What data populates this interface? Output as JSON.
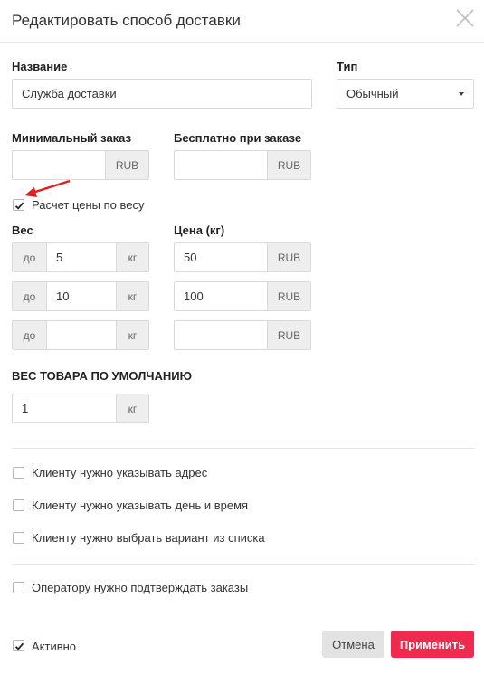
{
  "dialog": {
    "title": "Редактировать способ доставки"
  },
  "name_field": {
    "label": "Название",
    "value": "Служба доставки"
  },
  "type_field": {
    "label": "Тип",
    "value": "Обычный"
  },
  "min_order": {
    "label": "Минимальный заказ",
    "value": "",
    "currency": "RUB"
  },
  "free_order": {
    "label": "Бесплатно при заказе",
    "value": "",
    "currency": "RUB"
  },
  "weight_pricing": {
    "checkbox_label": "Расчет цены по весу",
    "checked": true,
    "weight_label": "Вес",
    "price_label": "Цена (кг)",
    "rows": [
      {
        "prefix": "до",
        "weight": "5",
        "unit": "кг",
        "price": "50",
        "currency": "RUB"
      },
      {
        "prefix": "до",
        "weight": "10",
        "unit": "кг",
        "price": "100",
        "currency": "RUB"
      },
      {
        "prefix": "до",
        "weight": "",
        "unit": "кг",
        "price": "",
        "currency": "RUB"
      }
    ]
  },
  "default_weight": {
    "label": "ВЕС ТОВАРА ПО УМОЛЧАНИЮ",
    "value": "1",
    "unit": "кг"
  },
  "options": {
    "address": {
      "label": "Клиенту нужно указывать адрес",
      "checked": false
    },
    "datetime": {
      "label": "Клиенту нужно указывать день и время",
      "checked": false
    },
    "variant": {
      "label": "Клиенту нужно выбрать вариант из списка",
      "checked": false
    },
    "operator": {
      "label": "Оператору нужно подтверждать заказы",
      "checked": false
    }
  },
  "footer": {
    "active_label": "Активно",
    "active_checked": true,
    "cancel_label": "Отмена",
    "apply_label": "Применить"
  },
  "colors": {
    "accent": "#f0294f",
    "annotation_arrow": "#e02020"
  }
}
